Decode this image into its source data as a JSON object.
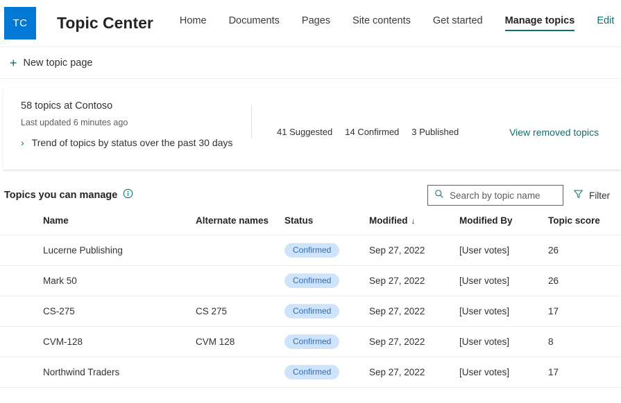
{
  "header": {
    "logo_text": "TC",
    "logo_color": "#0078d4",
    "site_title": "Topic Center",
    "nav": [
      {
        "label": "Home",
        "state": "normal"
      },
      {
        "label": "Documents",
        "state": "normal"
      },
      {
        "label": "Pages",
        "state": "normal"
      },
      {
        "label": "Site contents",
        "state": "normal"
      },
      {
        "label": "Get started",
        "state": "normal"
      },
      {
        "label": "Manage topics",
        "state": "active"
      },
      {
        "label": "Edit",
        "state": "link"
      }
    ],
    "accent_color": "#0f6e6e"
  },
  "command_bar": {
    "new_topic_page_label": "New topic page",
    "plus_glyph": "+"
  },
  "summary_card": {
    "title": "58 topics at Contoso",
    "last_updated": "Last updated 6 minutes ago",
    "trend_label": "Trend of topics by status over the past 30 days",
    "chevron_glyph": "›",
    "stats": [
      "41 Suggested",
      "14 Confirmed",
      "3 Published"
    ],
    "view_removed_label": "View removed topics"
  },
  "section": {
    "title": "Topics you can manage",
    "search_placeholder": "Search by topic name",
    "search_value": "",
    "filter_label": "Filter"
  },
  "table": {
    "columns": [
      {
        "key": "name",
        "label": "Name"
      },
      {
        "key": "alternate_names",
        "label": "Alternate names"
      },
      {
        "key": "status",
        "label": "Status"
      },
      {
        "key": "modified",
        "label": "Modified",
        "sorted": true,
        "sort_arrow": "↓"
      },
      {
        "key": "modified_by",
        "label": "Modified By"
      },
      {
        "key": "topic_score",
        "label": "Topic score"
      }
    ],
    "rows": [
      {
        "name": "Lucerne Publishing",
        "alternate_names": "",
        "status": "Confirmed",
        "modified": "Sep 27, 2022",
        "modified_by": "[User votes]",
        "topic_score": "26"
      },
      {
        "name": "Mark 50",
        "alternate_names": "",
        "status": "Confirmed",
        "modified": "Sep 27, 2022",
        "modified_by": "[User votes]",
        "topic_score": "26"
      },
      {
        "name": "CS-275",
        "alternate_names": "CS 275",
        "status": "Confirmed",
        "modified": "Sep 27, 2022",
        "modified_by": "[User votes]",
        "topic_score": "17"
      },
      {
        "name": "CVM-128",
        "alternate_names": "CVM 128",
        "status": "Confirmed",
        "modified": "Sep 27, 2022",
        "modified_by": "[User votes]",
        "topic_score": "8"
      },
      {
        "name": "Northwind Traders",
        "alternate_names": "",
        "status": "Confirmed",
        "modified": "Sep 27, 2022",
        "modified_by": "[User votes]",
        "topic_score": "17"
      }
    ],
    "status_badge_bg": "#cfe4fa",
    "status_badge_fg": "#2b6cb8"
  }
}
